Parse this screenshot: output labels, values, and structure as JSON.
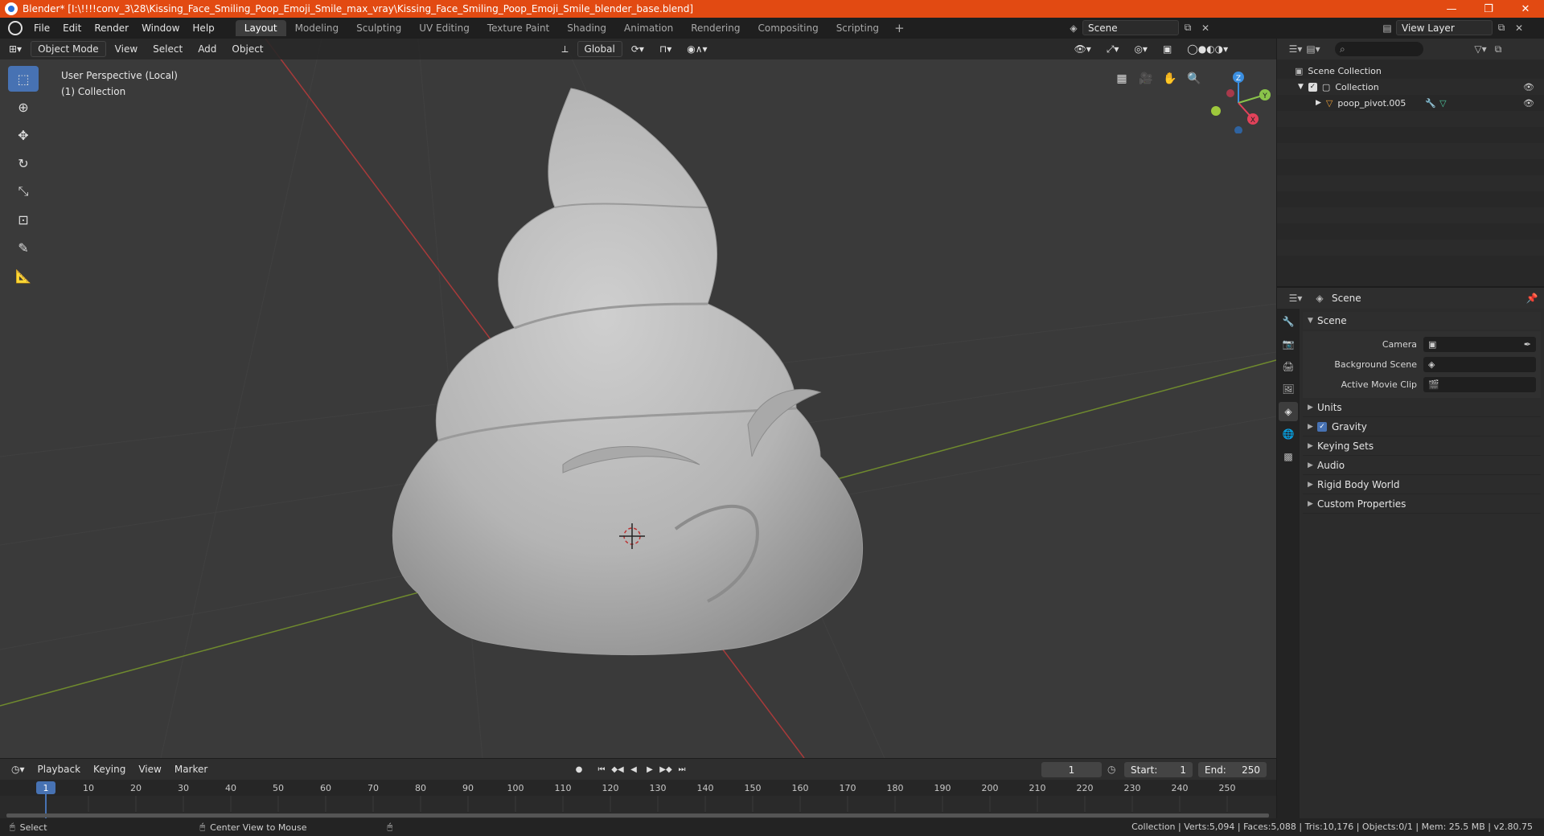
{
  "window": {
    "title": "Blender* [I:\\!!!!conv_3\\28\\Kissing_Face_Smiling_Poop_Emoji_Smile_max_vray\\Kissing_Face_Smiling_Poop_Emoji_Smile_blender_base.blend]",
    "controls": [
      "—",
      "❐",
      "✕"
    ]
  },
  "menubar": {
    "menus": [
      "File",
      "Edit",
      "Render",
      "Window",
      "Help"
    ],
    "workspaces": [
      "Layout",
      "Modeling",
      "Sculpting",
      "UV Editing",
      "Texture Paint",
      "Shading",
      "Animation",
      "Rendering",
      "Compositing",
      "Scripting"
    ],
    "active_workspace": "Layout",
    "add_tab": "+",
    "scene": "Scene",
    "view_layer": "View Layer"
  },
  "viewport": {
    "mode": "Object Mode",
    "menus": [
      "View",
      "Select",
      "Add",
      "Object"
    ],
    "transform_orientation": "Global",
    "info_line1": "User Perspective (Local)",
    "info_line2": "(1) Collection",
    "gizmo_axes": {
      "x": "X",
      "y": "Y",
      "z": "Z"
    }
  },
  "outliner": {
    "root": "Scene Collection",
    "collection": "Collection",
    "object": "poop_pivot.005"
  },
  "properties": {
    "context": "Scene",
    "panel": "Scene",
    "fields": [
      {
        "label": "Camera",
        "value": ""
      },
      {
        "label": "Background Scene",
        "value": ""
      },
      {
        "label": "Active Movie Clip",
        "value": ""
      }
    ],
    "sections": [
      "Units",
      "Gravity",
      "Keying Sets",
      "Audio",
      "Rigid Body World",
      "Custom Properties"
    ],
    "gravity_enabled": true
  },
  "timeline": {
    "menus": [
      "Playback",
      "Keying",
      "View",
      "Marker"
    ],
    "current_frame": "1",
    "start_label": "Start:",
    "start": "1",
    "end_label": "End:",
    "end": "250",
    "ticks": [
      "1",
      "10",
      "20",
      "30",
      "40",
      "50",
      "60",
      "70",
      "80",
      "90",
      "100",
      "110",
      "120",
      "130",
      "140",
      "150",
      "160",
      "170",
      "180",
      "190",
      "200",
      "210",
      "220",
      "230",
      "240",
      "250"
    ]
  },
  "statusbar": {
    "left_action": "Select",
    "middle_action": "Center View to Mouse",
    "stats": "Collection | Verts:5,094 | Faces:5,088 | Tris:10,176 | Objects:0/1 | Mem: 25.5 MB | v2.80.75"
  },
  "colors": {
    "titlebar": "#e24a12",
    "accent": "#4772b3",
    "x_axis": "#e2425a",
    "y_axis": "#8ac44a",
    "z_axis": "#3a8ee0"
  }
}
